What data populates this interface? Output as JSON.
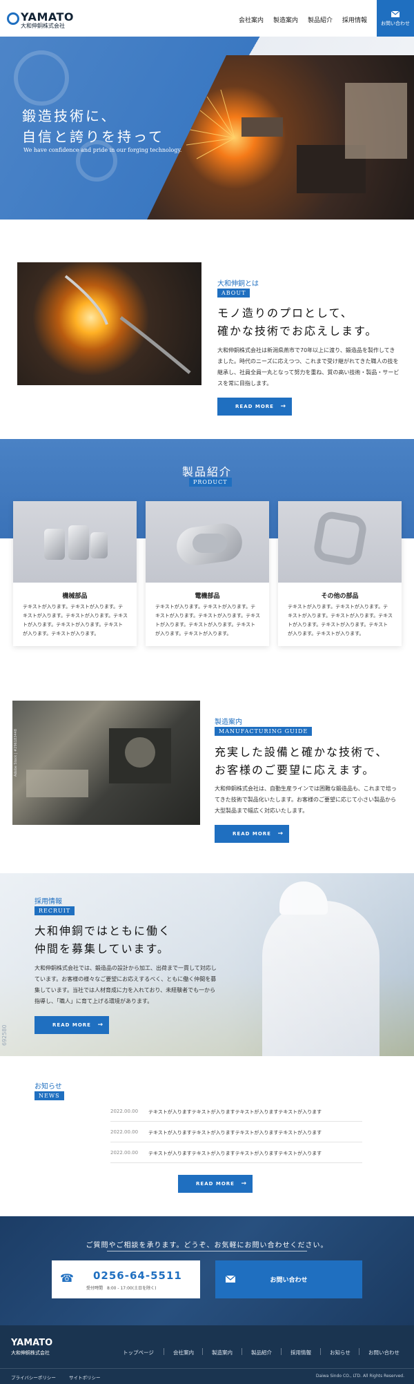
{
  "header": {
    "logo_word": "YAMATO",
    "logo_sub": "大和伸銅株式会社",
    "nav": [
      "会社案内",
      "製造案内",
      "製品紹介",
      "採用情報"
    ],
    "contact_label": "お問い合わせ"
  },
  "hero": {
    "title_line1": "鍛造技術に、",
    "title_line2": "自信と誇りを持って",
    "subtitle": "We have confidence and pride in our forging technology."
  },
  "about": {
    "label": "大和伸銅とは",
    "tag": "ABOUT",
    "heading_line1": "モノ造りのプロとして、",
    "heading_line2": "確かな技術でお応えします。",
    "body": "大和伸銅株式会社は新潟県燕市で70年以上に渡り、鍛造品を製作してきました。時代のニーズに応えつつ、これまで受け継がれてきた職人の技を継承し、社員全員一丸となって努力を重ね、質の高い技術・製品・サービスを常に目指します。",
    "button": "READ MORE"
  },
  "products": {
    "title": "製品紹介",
    "tag": "PRODUCT",
    "cards": [
      {
        "name": "機械部品",
        "text": "テキストが入ります。テキストが入ります。テキストが入ります。テキストが入ります。テキストが入ります。テキストが入ります。テキストが入ります。テキストが入ります。"
      },
      {
        "name": "電機部品",
        "text": "テキストが入ります。テキストが入ります。テキストが入ります。テキストが入ります。テキストが入ります。テキストが入ります。テキストが入ります。テキストが入ります。"
      },
      {
        "name": "その他の部品",
        "text": "テキストが入ります。テキストが入ります。テキストが入ります。テキストが入ります。テキストが入ります。テキストが入ります。テキストが入ります。テキストが入ります。"
      }
    ]
  },
  "manufacturing": {
    "label": "製造案内",
    "tag": "MANUFACTURING GUIDE",
    "heading_line1": "充実した設備と確かな技術で、",
    "heading_line2": "お客様のご要望に応えます。",
    "body": "大和伸銅株式会社は、自動生産ラインでは困難な鍛造品も、これまで培ってきた技術で製品化いたします。お客様のご要望に応じて小さい製品から大型製品まで幅広く対応いたします。",
    "button": "READ MORE",
    "photo_credit": "Adobe Stock | #296183448"
  },
  "recruit": {
    "label": "採用情報",
    "tag": "RECRUIT",
    "heading_line1": "大和伸銅ではともに働く",
    "heading_line2": "仲間を募集しています。",
    "body": "大和伸銅株式会社では、鍛造品の設計から加工、出荷まで一貫して対応しています。お客様の様々なご要望にお応えするべく、ともに働く仲間を募集しています。当社では人材育成に力を入れており、未経験者でも一から指導し、「職人」に育て上げる環境があります。",
    "button": "READ MORE",
    "photo_credit": "692580"
  },
  "news": {
    "label": "お知らせ",
    "tag": "NEWS",
    "items": [
      {
        "date": "2022.00.00",
        "title": "テキストが入りますテキストが入りますテキストが入りますテキストが入ります"
      },
      {
        "date": "2022.00.00",
        "title": "テキストが入りますテキストが入りますテキストが入りますテキストが入ります"
      },
      {
        "date": "2022.00.00",
        "title": "テキストが入りますテキストが入りますテキストが入りますテキストが入ります"
      }
    ],
    "button": "READ MORE"
  },
  "cta": {
    "lead": "ご質問やご相談を承ります。どうぞ、お気軽にお問い合わせください。",
    "tel": "0256-64-5511",
    "hours": "受付時間　8:00 - 17:00(土日を除く)",
    "mail_label": "お問い合わせ"
  },
  "footer": {
    "logo_word": "YAMATO",
    "logo_sub": "大和伸銅株式会社",
    "nav": [
      "トップページ",
      "会社案内",
      "製造案内",
      "製品紹介",
      "採用情報",
      "お知らせ",
      "お問い合わせ"
    ],
    "privacy": "プライバシーポリシー",
    "sitepolicy": "サイトポリシー",
    "copyright": "Daiwa Sindo CO., LTD. All Rights Reserved."
  },
  "colors": {
    "accent": "#1f6fc0",
    "footer": "#1a3450"
  }
}
